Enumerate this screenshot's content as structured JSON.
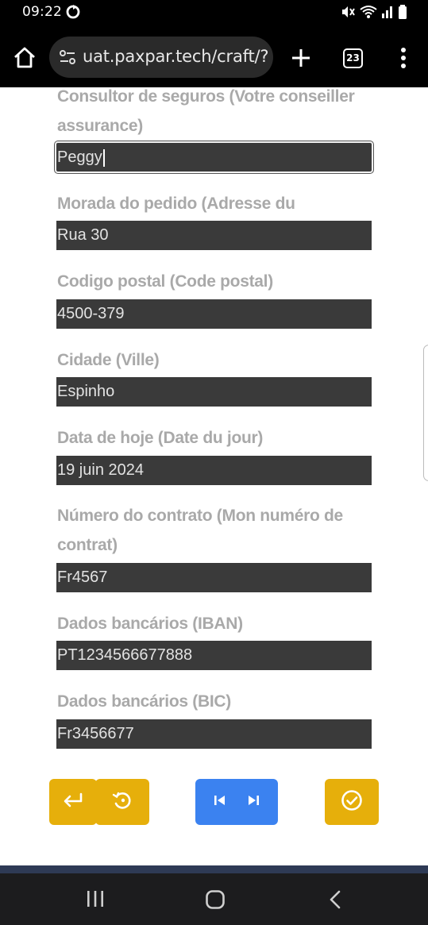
{
  "status_bar": {
    "time": "09:22"
  },
  "browser": {
    "url": "uat.paxpar.tech/craft/?",
    "tab_count": "23"
  },
  "form": {
    "fields": [
      {
        "label": "Consultor de seguros (Votre conseiller assurance)",
        "value": "Peggy"
      },
      {
        "label": "Morada do pedido (Adresse du Sinistre)",
        "value": "Rua 30"
      },
      {
        "label": "Codigo postal (Code postal)",
        "value": "4500-379"
      },
      {
        "label": "Cidade (Ville)",
        "value": "Espinho"
      },
      {
        "label": "Data de hoje (Date du jour)",
        "value": "19 juin 2024"
      },
      {
        "label": "Número do contrato (Mon numéro de contrat)",
        "value": "Fr4567"
      },
      {
        "label": "Dados bancários (IBAN)",
        "value": "PT1234566677888"
      },
      {
        "label": "Dados bancários (BIC)",
        "value": "Fr3456677"
      }
    ]
  },
  "actions": {
    "back_icon": "enter-return-icon",
    "reset_icon": "restore-icon",
    "first_icon": "skip-previous-icon",
    "last_icon": "skip-next-icon",
    "submit_icon": "check-circle-icon"
  },
  "colors": {
    "yellow": "#e6af0b",
    "blue": "#3b82f0",
    "input_bg": "#3a3a3a",
    "label": "#a9a9a9"
  }
}
